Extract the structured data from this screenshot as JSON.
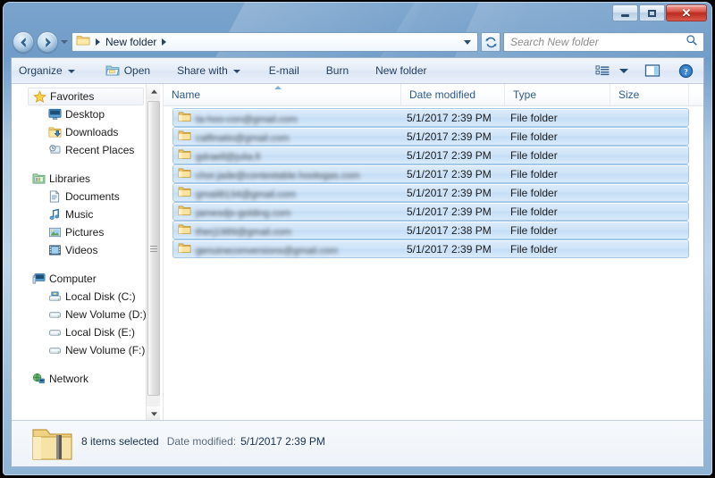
{
  "window": {
    "title": "New folder",
    "controls": {
      "minimize": "Minimize",
      "maximize": "Maximize",
      "close": "Close",
      "close_glyph": "✕"
    }
  },
  "navigation": {
    "back": "Back",
    "forward": "Forward",
    "history_dropdown": "Recent pages",
    "refresh": "Refresh",
    "breadcrumb": [
      {
        "label": "New folder"
      }
    ],
    "address_dropdown": "Previous locations"
  },
  "search": {
    "placeholder": "Search New folder",
    "value": "",
    "icon": "search-icon"
  },
  "toolbar": {
    "items": [
      {
        "label": "Organize",
        "caret": true,
        "icon": null
      },
      {
        "label": "Open",
        "caret": false,
        "icon": "open-folder-icon"
      },
      {
        "label": "Share with",
        "caret": true,
        "icon": null
      },
      {
        "label": "E-mail",
        "caret": false,
        "icon": null
      },
      {
        "label": "Burn",
        "caret": false,
        "icon": null
      },
      {
        "label": "New folder",
        "caret": false,
        "icon": null
      }
    ],
    "view_button": "change-view-icon",
    "view_caret": "chevron-down-icon",
    "preview_pane_button": "preview-pane-icon",
    "help_button": "help-icon"
  },
  "sidebar": {
    "groups": [
      {
        "header": {
          "label": "Favorites",
          "icon": "star-icon",
          "selected": true
        },
        "items": [
          {
            "label": "Desktop",
            "icon": "desktop-icon"
          },
          {
            "label": "Downloads",
            "icon": "downloads-icon"
          },
          {
            "label": "Recent Places",
            "icon": "recent-places-icon"
          }
        ]
      },
      {
        "header": {
          "label": "Libraries",
          "icon": "libraries-icon",
          "selected": false
        },
        "items": [
          {
            "label": "Documents",
            "icon": "documents-icon"
          },
          {
            "label": "Music",
            "icon": "music-icon"
          },
          {
            "label": "Pictures",
            "icon": "pictures-icon"
          },
          {
            "label": "Videos",
            "icon": "videos-icon"
          }
        ]
      },
      {
        "header": {
          "label": "Computer",
          "icon": "computer-icon",
          "selected": false
        },
        "items": [
          {
            "label": "Local Disk (C:)",
            "icon": "system-drive-icon"
          },
          {
            "label": "New Volume (D:)",
            "icon": "drive-icon"
          },
          {
            "label": "Local Disk (E:)",
            "icon": "drive-icon"
          },
          {
            "label": "New Volume (F:)",
            "icon": "drive-icon"
          }
        ]
      },
      {
        "header": {
          "label": "Network",
          "icon": "network-icon",
          "selected": false
        },
        "items": []
      }
    ],
    "scrollbar": {
      "up_arrow": "▲",
      "down_arrow": "▼"
    }
  },
  "filelist": {
    "columns": [
      {
        "key": "name",
        "label": "Name",
        "sorted": "asc"
      },
      {
        "key": "date",
        "label": "Date modified",
        "sorted": null
      },
      {
        "key": "type",
        "label": "Type",
        "sorted": null
      },
      {
        "key": "size",
        "label": "Size",
        "sorted": null
      }
    ],
    "rows": [
      {
        "name": "ta-hoo-con@gmail.com",
        "date": "5/1/2017 2:39 PM",
        "type": "File folder",
        "size": "",
        "selected": true,
        "redacted": true,
        "icon": "folder-icon"
      },
      {
        "name": "calfinatio@gmail.com",
        "date": "5/1/2017 2:39 PM",
        "type": "File folder",
        "size": "",
        "selected": true,
        "redacted": true,
        "icon": "folder-icon"
      },
      {
        "name": "gdraell@julia.fi",
        "date": "5/1/2017 2:39 PM",
        "type": "File folder",
        "size": "",
        "selected": true,
        "redacted": true,
        "icon": "folder-icon"
      },
      {
        "name": "chor.jade@contestable.hoologas.com",
        "date": "5/1/2017 2:39 PM",
        "type": "File folder",
        "size": "",
        "selected": true,
        "redacted": true,
        "icon": "folder-icon"
      },
      {
        "name": "gmail8134@gmail.com",
        "date": "5/1/2017 2:39 PM",
        "type": "File folder",
        "size": "",
        "selected": true,
        "redacted": true,
        "icon": "folder-icon"
      },
      {
        "name": "jamesdjs-golding.com",
        "date": "5/1/2017 2:39 PM",
        "type": "File folder",
        "size": "",
        "selected": true,
        "redacted": true,
        "icon": "folder-icon"
      },
      {
        "name": "therj1989@gmail.com",
        "date": "5/1/2017 2:38 PM",
        "type": "File folder",
        "size": "",
        "selected": true,
        "redacted": true,
        "icon": "folder-icon"
      },
      {
        "name": "genuineconversions@gmail.com",
        "date": "5/1/2017 2:39 PM",
        "type": "File folder",
        "size": "",
        "selected": true,
        "redacted": true,
        "icon": "folder-icon"
      }
    ]
  },
  "statusbar": {
    "icon": "folder-large-icon",
    "selection_text": "8 items selected",
    "date_label": "Date modified:",
    "date_value": "5/1/2017 2:39 PM"
  },
  "colors": {
    "selection_fill": "#cfe4f8",
    "selection_border": "#a3c8e8",
    "header_text": "#2b5a8a",
    "close_button": "#bb2a1f",
    "glass_top": "#7ba4cd"
  }
}
